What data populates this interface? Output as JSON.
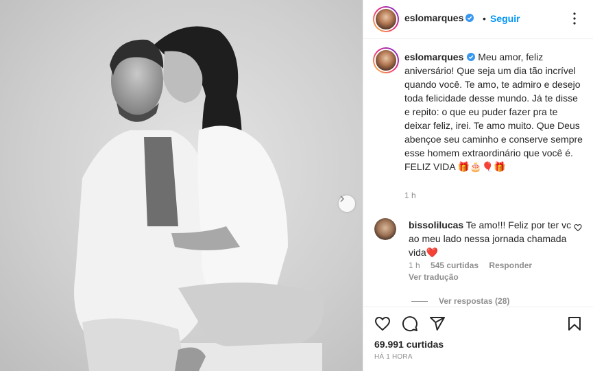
{
  "post": {
    "username": "eslomarques",
    "follow_label": "Seguir",
    "separator": "•",
    "caption_user": "eslomarques",
    "caption_text": "Meu amor, feliz aniversário! Que seja um dia tão incrível quando você. Te amo, te admiro e desejo toda felicidade desse mundo. Já te disse e repito: o que eu puder fazer pra te deixar feliz, irei. Te amo muito. Que Deus abençoe seu caminho e conserve sempre esse homem extraordinário que você é.",
    "caption_line2": "FELIZ VIDA 🎁🎂🎈🎁",
    "caption_time": "1 h",
    "likes": "69.991 curtidas",
    "posted_ago": "HÁ 1 HORA"
  },
  "comment": {
    "username": "bissolilucas",
    "text": "Te amo!!! Feliz por ter vc ao meu lado nessa jornada chamada vida❤️",
    "time": "1 h",
    "likes": "545 curtidas",
    "reply_label": "Responder",
    "translate_label": "Ver tradução",
    "view_replies": "Ver respostas (28)"
  },
  "icons": {
    "verified": "verified-badge-icon",
    "more": "more-options-icon",
    "next": "chevron-right-icon",
    "like": "heart-icon",
    "comment": "comment-icon",
    "share": "share-icon",
    "save": "bookmark-icon"
  },
  "colors": {
    "accent": "#0095f6",
    "muted": "#8e8e8e",
    "text": "#262626"
  }
}
